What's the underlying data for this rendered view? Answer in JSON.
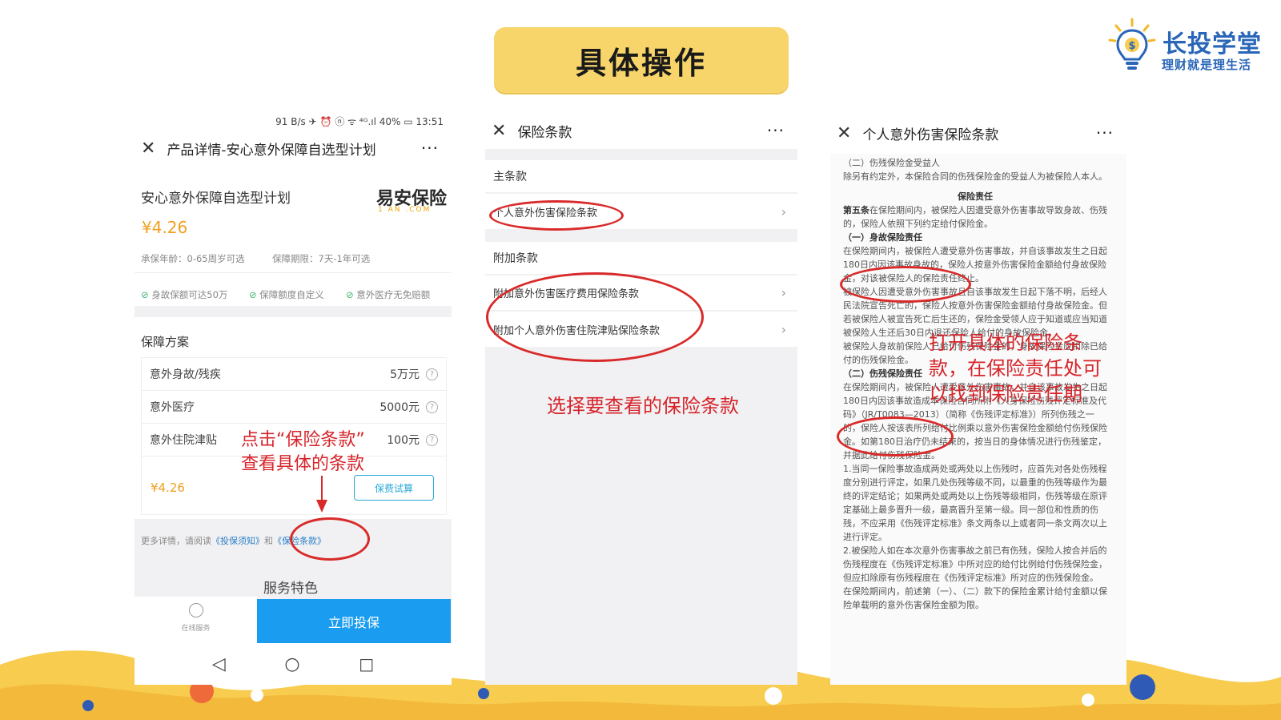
{
  "title": "具体操作",
  "logo": {
    "name": "长投学堂",
    "slogan": "理财就是理生活"
  },
  "phone1": {
    "status": "91 B/s  ✈ ⏰ ⓝ ᯤ ⁴ᴳ.ıl 40%  ▭ 13:51",
    "nav_title": "产品详情-安心意外保障自选型计划",
    "more": "···",
    "product_name": "安心意外保障自选型计划",
    "brand": "易安保险",
    "brand_sub": "1 AN .COM",
    "price": "¥4.26",
    "age_info": "承保年龄：0-65周岁可选",
    "period_info": "保障期限：7天-1年可选",
    "features": [
      "身故保额可达50万",
      "保障额度自定义",
      "意外医疗无免赔额"
    ],
    "plan_heading": "保障方案",
    "plan_rows": [
      {
        "label": "意外身故/残疾",
        "value": "5万元"
      },
      {
        "label": "意外医疗",
        "value": "5000元"
      },
      {
        "label": "意外住院津贴",
        "value": "100元"
      }
    ],
    "plan_price": "¥4.26",
    "calc_button": "保费试算",
    "more_details_prefix": "更多详情，请阅读",
    "link_notice": "《投保须知》",
    "link_sep": "和",
    "link_terms": "《保险条款》",
    "service_heading": "服务特色",
    "online_service": "在线服务",
    "buy_button": "立即投保"
  },
  "phone2": {
    "nav_title": "保险条款",
    "more": "···",
    "main_section": "主条款",
    "main_items": [
      "个人意外伤害保险条款"
    ],
    "addon_section": "附加条款",
    "addon_items": [
      "附加意外伤害医疗费用保险条款",
      "附加个人意外伤害住院津贴保险条款"
    ]
  },
  "phone3": {
    "nav_title": "个人意外伤害保险条款",
    "more": "···",
    "p1": "（二）伤残保险金受益人",
    "p2": "除另有约定外，本保险合同的伤残保险金的受益人为被保险人本人。",
    "heading": "保险责任",
    "p3_bold": "第五条",
    "p3": "在保险期间内，被保险人因遭受意外伤害事故导致身故、伤残的，保险人依照下列约定给付保险金。",
    "s1": "（一）身故保险责任",
    "p4": "在保险期间内，被保险人遭受意外伤害事故，并自该事故发生之日起180日内因该事故身故的，保险人按意外伤害保险金额给付身故保险金，对该被保险人的保险责任终止。",
    "p5": "被保险人因遭受意外伤害事故且自该事故发生日起下落不明，后经人民法院宣告死亡的，保险人按意外伤害保险金额给付身故保险金。但若被保险人被宣告死亡后生还的，保险金受领人应于知道或应当知道被保险人生还后30日内退还保险人给付的身故保险金。",
    "p6": "被保险人身故前保险人已给付伤残保险金的，身故保险金应扣除已给付的伤残保险金。",
    "s2": "（二）伤残保险责任",
    "p7": "在保险期间内，被保险人遭受意外伤害事故，并自该事故发生之日起180日内因该事故造成本保险合同所附《人身保险伤残评定标准及代码》（JR/T0083—2013）（简称《伤残评定标准》）所列伤残之一的，保险人按该表所列给付比例乘以意外伤害保险金额给付伤残保险金。如第180日治疗仍未结束的，按当日的身体情况进行伤残鉴定，并据此给付伤残保险金。",
    "p8": "1.当同一保险事故造成两处或两处以上伤残时，应首先对各处伤残程度分别进行评定，如果几处伤残等级不同，以最重的伤残等级作为最终的评定结论；如果两处或两处以上伤残等级相同，伤残等级在原评定基础上最多晋升一级，最高晋升至第一级。同一部位和性质的伤残，不应采用《伤残评定标准》条文两条以上或者同一条文两次以上进行评定。",
    "p9": "2.被保险人如在本次意外伤害事故之前已有伤残，保险人按合并后的伤残程度在《伤残评定标准》中所对应的给付比例给付伤残保险金，但应扣除原有伤残程度在《伤残评定标准》所对应的伤残保险金。",
    "p10": "在保险期间内，前述第（一）、（二）款下的保险金累计给付金额以保险单载明的意外伤害保险金额为限。"
  },
  "annotations": {
    "a1_line1": "点击“保险条款”",
    "a1_line2": "查看具体的条款",
    "a2": "选择要查看的保险条款",
    "a3_line1": "打开具体的保险条",
    "a3_line2": "款，在保险责任处可",
    "a3_line3": "以找到保险责任期"
  },
  "colors": {
    "accent_red": "#d92a2a",
    "banner_yellow": "#f7d56b",
    "buy_blue": "#1a9cf0",
    "logo_blue": "#2a66b8"
  }
}
